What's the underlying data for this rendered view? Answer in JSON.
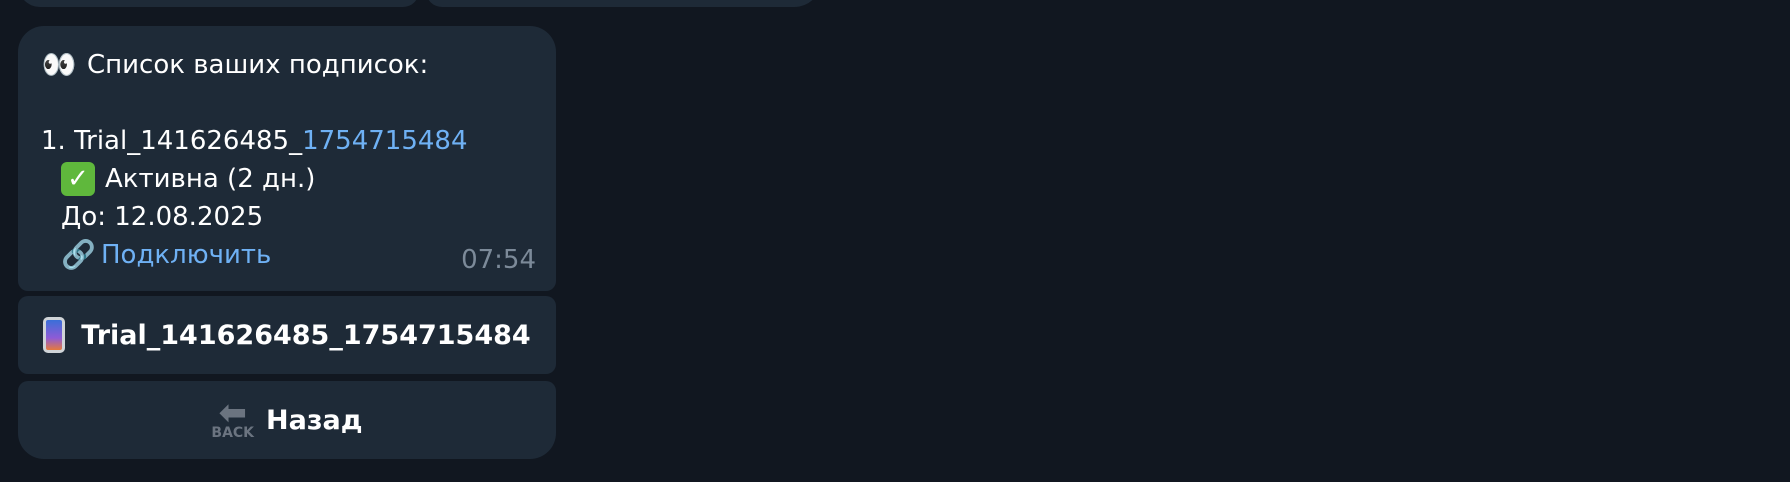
{
  "message": {
    "header_icon": "eyes-icon",
    "header_text": "Список ваших подписок:",
    "item_prefix": "1. Trial_141626485_",
    "item_link": "1754715484",
    "status_icon": "check-mark-icon",
    "status_text": "Активна (2 дн.)",
    "until_text": "До: 12.08.2025",
    "connect_icon": "link-icon",
    "connect_text": "Подключить",
    "time": "07:54"
  },
  "keyboard": {
    "subscription_button": "Trial_141626485_1754715484",
    "back_button": "Назад",
    "back_icon_label": "BACK"
  },
  "colors": {
    "background": "#111720",
    "bubble": "#1e2a37",
    "link": "#6fb1f4",
    "time": "#7c8a99"
  }
}
